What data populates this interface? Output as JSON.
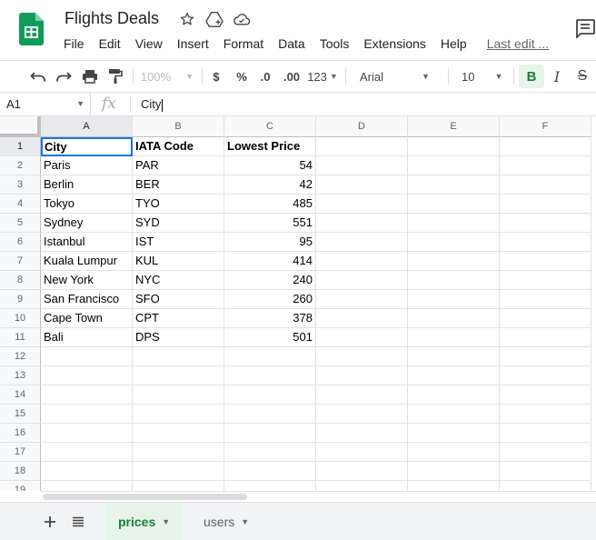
{
  "doc": {
    "title": "Flights Deals"
  },
  "menu": [
    "File",
    "Edit",
    "View",
    "Insert",
    "Format",
    "Data",
    "Tools",
    "Extensions",
    "Help"
  ],
  "last_edit": "Last edit ...",
  "toolbar": {
    "zoom": "100%",
    "currency": "$",
    "percent": "%",
    "dec_decrease": ".0",
    "dec_increase": ".00",
    "more_formats": "123",
    "font": "Arial",
    "font_size": "10",
    "bold": "B",
    "italic": "I",
    "strike": "S"
  },
  "formula_bar": {
    "name_box": "A1",
    "fx": "fx",
    "value": "City"
  },
  "columns": [
    "A",
    "B",
    "C",
    "D",
    "E",
    "F"
  ],
  "rows": [
    "1",
    "2",
    "3",
    "4",
    "5",
    "6",
    "7",
    "8",
    "9",
    "10",
    "11",
    "12",
    "13",
    "14",
    "15",
    "16",
    "17",
    "18",
    "19"
  ],
  "table": [
    [
      "City",
      "IATA Code",
      "Lowest Price"
    ],
    [
      "Paris",
      "PAR",
      "54"
    ],
    [
      "Berlin",
      "BER",
      "42"
    ],
    [
      "Tokyo",
      "TYO",
      "485"
    ],
    [
      "Sydney",
      "SYD",
      "551"
    ],
    [
      "Istanbul",
      "IST",
      "95"
    ],
    [
      "Kuala Lumpur",
      "KUL",
      "414"
    ],
    [
      "New York",
      "NYC",
      "240"
    ],
    [
      "San Francisco",
      "SFO",
      "260"
    ],
    [
      "Cape Town",
      "CPT",
      "378"
    ],
    [
      "Bali",
      "DPS",
      "501"
    ]
  ],
  "sheets": {
    "active": "prices",
    "other": "users"
  },
  "colors": {
    "accent": "#1a73e8",
    "sheets_green": "#188038",
    "active_tab_bg": "#e6f4ea"
  },
  "icons": [
    "sheets-logo-icon",
    "star-icon",
    "move-to-drive-icon",
    "cloud-status-icon",
    "comment-icon",
    "undo-icon",
    "redo-icon",
    "print-icon",
    "paint-format-icon",
    "add-sheet-icon",
    "all-sheets-icon"
  ]
}
